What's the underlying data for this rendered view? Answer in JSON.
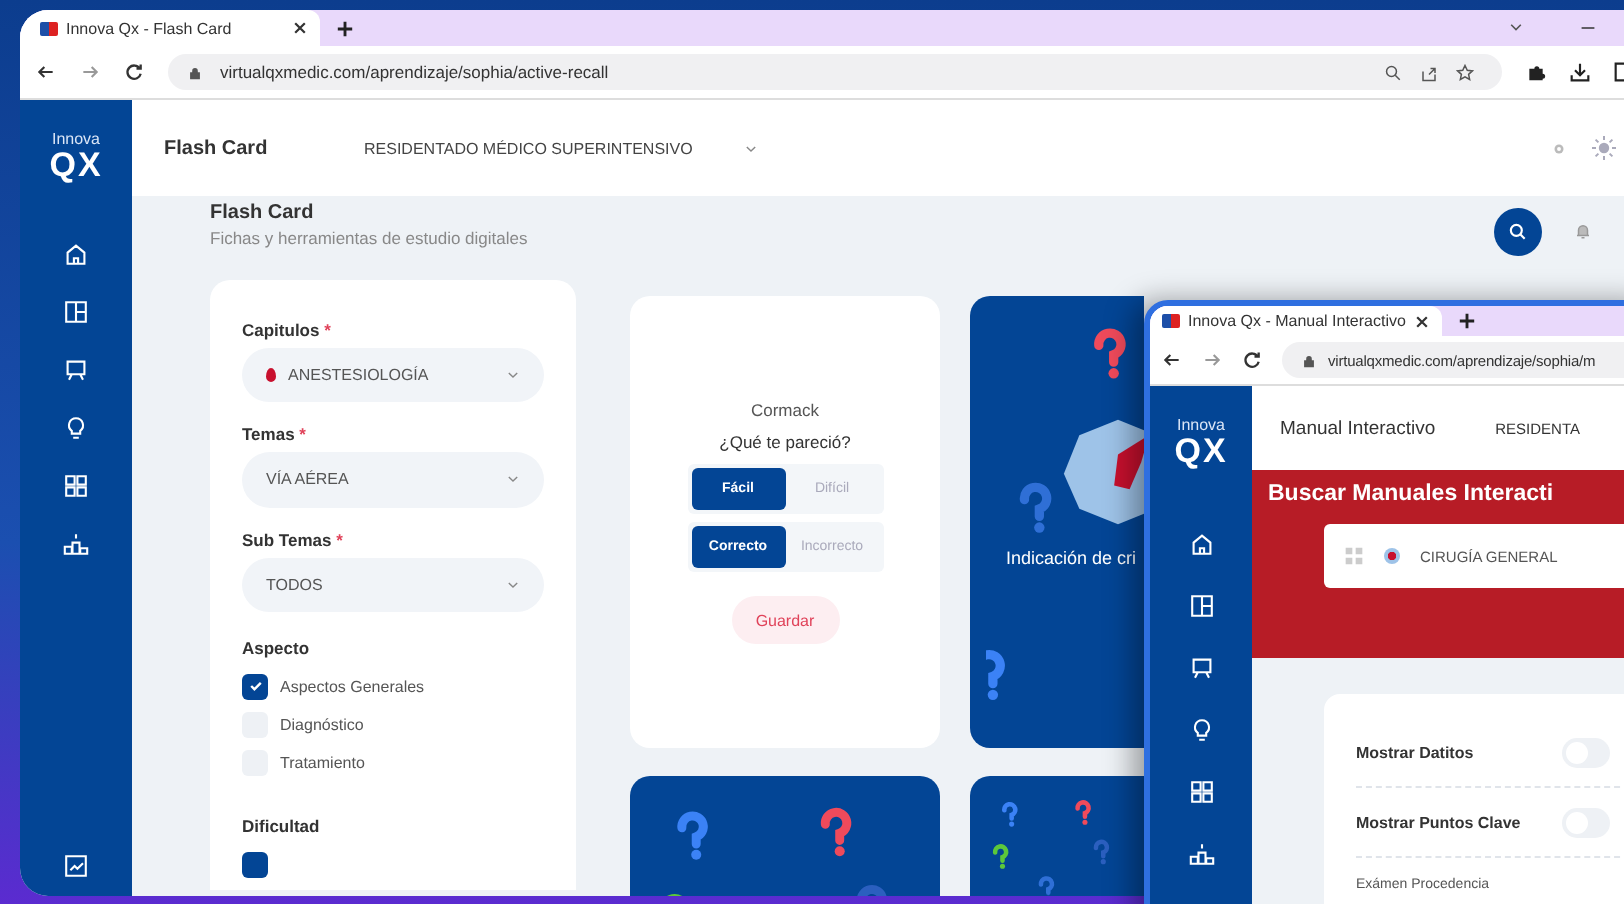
{
  "browser": {
    "tab_title": "Innova Qx - Flash Card",
    "url": "virtualqxmedic.com/aprendizaje/sophia/active-recall"
  },
  "logo": {
    "top": "Innova",
    "bottom": "QX"
  },
  "sidebar": {
    "items": [
      {
        "kind": "home"
      },
      {
        "kind": "layout"
      },
      {
        "kind": "board"
      },
      {
        "kind": "bulb"
      },
      {
        "kind": "apps"
      },
      {
        "kind": "podium"
      }
    ],
    "bottom": {
      "kind": "chart"
    }
  },
  "header": {
    "title": "Flash Card",
    "program": "RESIDENTADO MÉDICO SUPERINTENSIVO"
  },
  "page": {
    "title": "Flash Card",
    "subtitle": "Fichas y herramientas de estudio digitales"
  },
  "filters": {
    "fields": [
      {
        "label": "Capitulos",
        "mark": "*",
        "value": "ANESTESIOLOGÍA",
        "with_icon": true
      },
      {
        "label": "Temas",
        "mark": "*",
        "value": "VÍA AÉREA",
        "with_icon": false
      },
      {
        "label": "Sub Temas",
        "mark": "*",
        "value": "TODOS",
        "with_icon": false
      }
    ],
    "aspect": {
      "label": "Aspecto",
      "options": [
        {
          "label": "Aspectos Generales",
          "checked": true
        },
        {
          "label": "Diagnóstico",
          "checked": false
        },
        {
          "label": "Tratamiento",
          "checked": false
        }
      ]
    },
    "difficulty": {
      "label": "Dificultad",
      "options": [
        {
          "checked": true
        }
      ]
    }
  },
  "cards": [
    {
      "kind": "answer",
      "title": "Cormack",
      "question": "¿Qué te pareció?",
      "groups": [
        [
          {
            "label": "Fácil",
            "selected": true
          },
          {
            "label": "Difícil",
            "selected": false
          }
        ],
        [
          {
            "label": "Correcto",
            "selected": true
          },
          {
            "label": "Incorrecto",
            "selected": false
          }
        ]
      ],
      "save": "Guardar"
    },
    {
      "kind": "front",
      "caption": "Indicación de cri"
    },
    {
      "kind": "back"
    },
    {
      "kind": "back"
    }
  ],
  "window2": {
    "tab_title": "Innova Qx - Manual Interactivo",
    "url": "virtualqxmedic.com/aprendizaje/sophia/m",
    "logo_top": "Innova",
    "logo_bottom": "QX",
    "sidebar": [
      {
        "kind": "home"
      },
      {
        "kind": "layout"
      },
      {
        "kind": "board"
      },
      {
        "kind": "bulb"
      },
      {
        "kind": "apps"
      },
      {
        "kind": "podium"
      }
    ],
    "header_title": "Manual Interactivo",
    "program": "RESIDENTA",
    "banner_title": "Buscar Manuales Interacti",
    "search_value": "CIRUGÍA GENERAL",
    "toggles": [
      {
        "label": "Mostrar Datitos",
        "on": false
      },
      {
        "label": "Mostrar Puntos Clave",
        "on": false
      }
    ],
    "field_label": "Exámen Procedencia"
  }
}
